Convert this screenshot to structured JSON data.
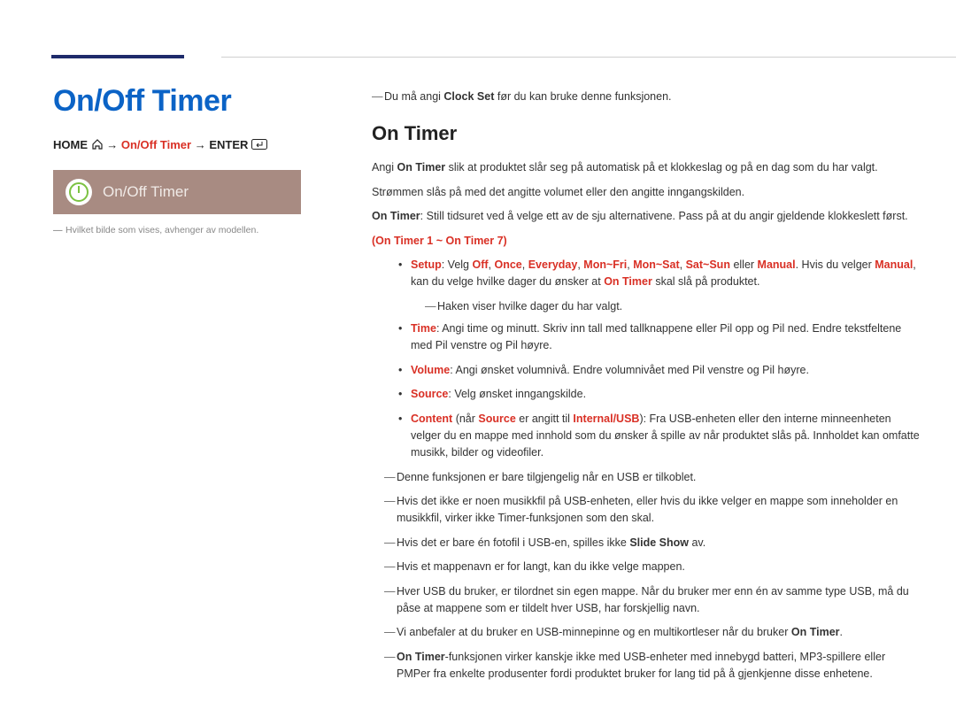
{
  "left": {
    "main_title": "On/Off Timer",
    "breadcrumb": {
      "home": "HOME",
      "arrow": "→",
      "mid": "On/Off Timer",
      "enter": "ENTER"
    },
    "tile_label": "On/Off Timer",
    "footnote": "Hvilket bilde som vises, avhenger av modellen."
  },
  "right": {
    "top_note_pre": "Du må angi ",
    "top_note_strong": "Clock Set",
    "top_note_post": " før du kan bruke denne funksjonen.",
    "heading": "On Timer",
    "p1_pre": "Angi ",
    "p1_strong": "On Timer",
    "p1_post": " slik at produktet slår seg på automatisk på et klokkeslag og på en dag som du har valgt.",
    "p2": "Strømmen slås på med det angitte volumet eller den angitte inngangskilden.",
    "p3_strong": "On Timer",
    "p3_post": ": Still tidsuret ved å velge ett av de sju alternativene. Pass på at du angir gjeldende klokkeslett først.",
    "p3_range": "(On Timer 1 ~ On Timer 7)",
    "setup": {
      "label": "Setup",
      "pre": ": Velg ",
      "opts_off": "Off",
      "opts_once": "Once",
      "opts_everyday": "Everyday",
      "opts_monfri": "Mon~Fri",
      "opts_monsat": "Mon~Sat",
      "opts_satsun": "Sat~Sun",
      "opts_manual": "Manual",
      "eller": " eller ",
      "sep": ", ",
      "post1": ". Hvis du velger ",
      "manual2": "Manual",
      "post2": ", kan du velge hvilke dager du ønsker at ",
      "ontimer": "On Timer",
      "post3": " skal slå på produktet.",
      "sub": "Haken viser hvilke dager du har valgt."
    },
    "time": {
      "label": "Time",
      "text": ": Angi time og minutt. Skriv inn tall med tallknappene eller Pil opp og Pil ned. Endre tekstfeltene med Pil venstre og Pil høyre."
    },
    "volume": {
      "label": "Volume",
      "text": ": Angi ønsket volumnivå. Endre volumnivået med Pil venstre og Pil høyre."
    },
    "source": {
      "label": "Source",
      "text": ": Velg ønsket inngangskilde."
    },
    "content": {
      "label": "Content",
      "paren_pre": " (når ",
      "src": "Source",
      "paren_mid": " er angitt til ",
      "iusb": "Internal/USB",
      "paren_post": "): Fra USB-enheten eller den interne minneenheten velger du en mappe med innhold som du ønsker å spille av når produktet slås på. Innholdet kan omfatte musikk, bilder og videofiler."
    },
    "notes": {
      "n1": "Denne funksjonen er bare tilgjengelig når en USB er tilkoblet.",
      "n2": "Hvis det ikke er noen musikkfil på USB-enheten, eller hvis du ikke velger en mappe som inneholder en musikkfil, virker ikke Timer-funksjonen som den skal.",
      "n3_pre": "Hvis det er bare én fotofil i USB-en, spilles ikke ",
      "n3_strong": "Slide Show",
      "n3_post": " av.",
      "n4": "Hvis et mappenavn er for langt, kan du ikke velge mappen.",
      "n5": "Hver USB du bruker, er tilordnet sin egen mappe. Når du bruker mer enn én av samme type USB, må du påse at mappene som er tildelt hver USB, har forskjellig navn.",
      "n6_pre": "Vi anbefaler at du bruker en USB-minnepinne og en multikortleser når du bruker ",
      "n6_strong": "On Timer",
      "n6_post": ".",
      "n7_strong": "On Timer",
      "n7_post": "-funksjonen virker kanskje ikke med USB-enheter med innebygd batteri, MP3-spillere eller PMPer fra enkelte produsenter fordi produktet bruker for lang tid på å gjenkjenne disse enhetene."
    }
  }
}
